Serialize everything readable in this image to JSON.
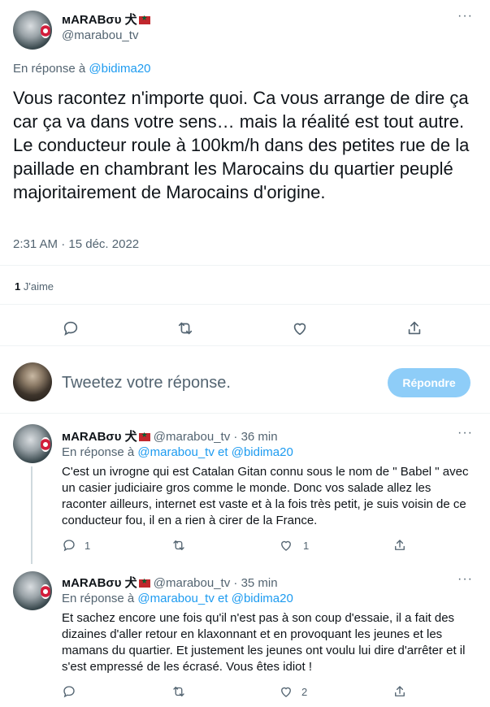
{
  "main_tweet": {
    "display_name": "мARABσυ 犬",
    "handle": "@marabou_tv",
    "reply_prefix": "En réponse à",
    "reply_to": "@bidima20",
    "text": "Vous racontez n'importe quoi. Ca vous arrange de dire ça car ça va dans votre sens… mais la réalité est tout autre. Le conducteur roule à 100km/h dans des petites rue de la paillade en chambrant les Marocains du quartier peuplé majoritairement de Marocains d'origine.",
    "time": "2:31 AM",
    "separator": "·",
    "date": "15 déc. 2022",
    "likes_count": "1",
    "likes_label": "J'aime"
  },
  "compose": {
    "placeholder": "Tweetez votre réponse.",
    "reply_button": "Répondre"
  },
  "replies": [
    {
      "display_name": "мARABσυ 犬",
      "handle": "@marabou_tv",
      "separator": "·",
      "time": "36 min",
      "reply_prefix": "En réponse à",
      "reply_to_1": "@marabou_tv",
      "reply_and": "et",
      "reply_to_2": "@bidima20",
      "text": "C'est un ivrogne qui est Catalan Gitan connu sous le nom de \" Babel \" avec un casier judiciaire gros comme le monde. Donc vos salade allez les raconter ailleurs, internet est vaste et à la fois très petit, je suis voisin de ce conducteur fou, il en a rien à cirer de la France.",
      "reply_count": "1",
      "retweet_count": "",
      "like_count": "1"
    },
    {
      "display_name": "мARABσυ 犬",
      "handle": "@marabou_tv",
      "separator": "·",
      "time": "35 min",
      "reply_prefix": "En réponse à",
      "reply_to_1": "@marabou_tv",
      "reply_and": "et",
      "reply_to_2": "@bidima20",
      "text": "Et sachez encore une fois qu'il n'est pas à son coup d'essaie, il a fait des dizaines d'aller retour en klaxonnant et en provoquant les jeunes et les mamans du quartier. Et justement les jeunes ont voulu lui dire d'arrêter et il s'est empressé de les écrasé. Vous êtes idiot !",
      "reply_count": "",
      "retweet_count": "",
      "like_count": "2"
    }
  ],
  "icons": {
    "more": "more-icon",
    "reply": "reply-icon",
    "retweet": "retweet-icon",
    "like": "heart-icon",
    "share": "share-icon"
  },
  "colors": {
    "accent": "#1d9bf0",
    "muted": "#536471",
    "button_disabled": "#8ecdf8"
  }
}
